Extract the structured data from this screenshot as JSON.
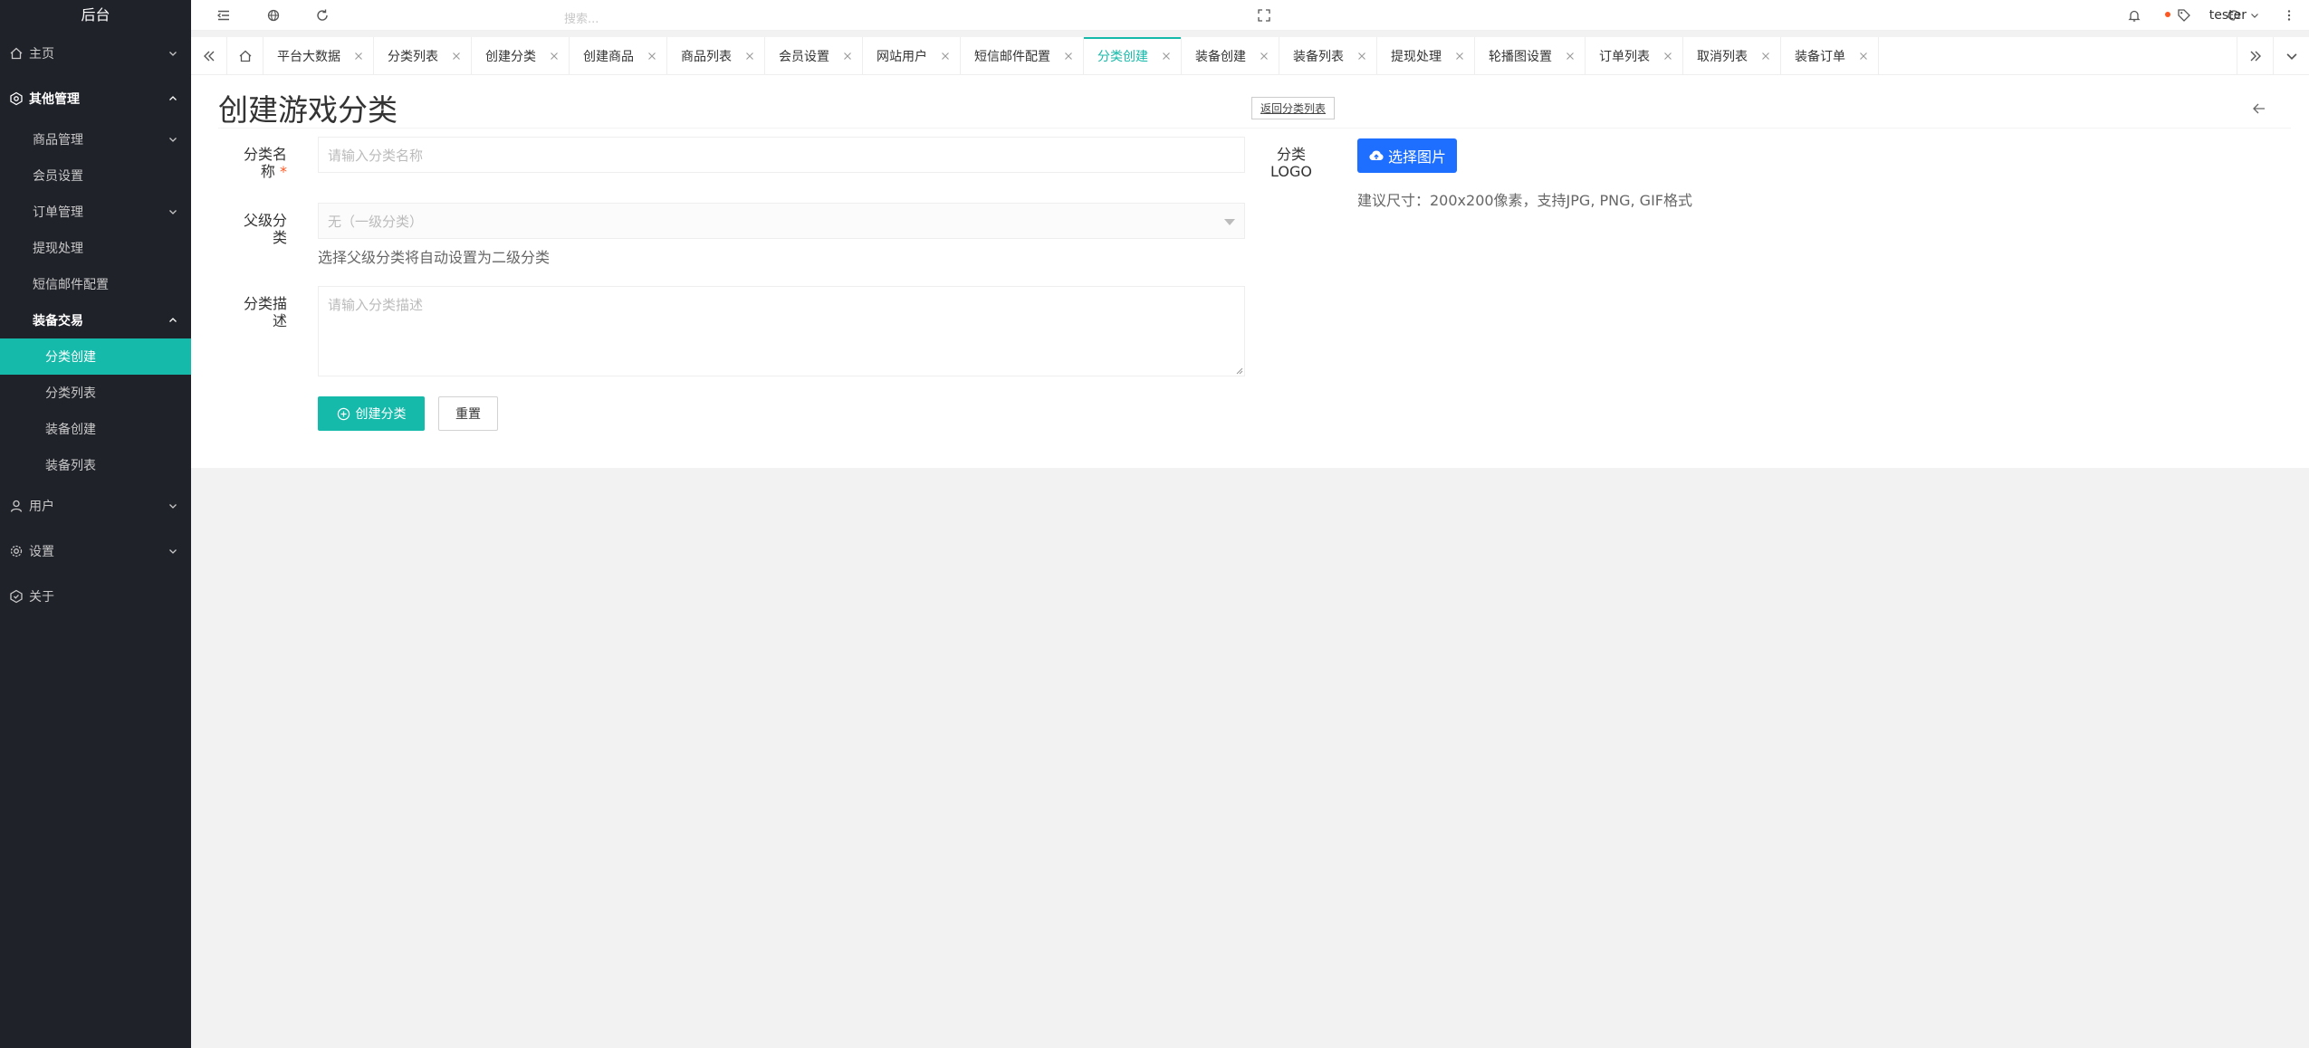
{
  "app": {
    "title": "后台"
  },
  "colors": {
    "accent": "#16baaa",
    "sidebar_bg": "#20222a",
    "upload_blue": "#1e6fff",
    "required": "#ff5722"
  },
  "sidebar": {
    "home": "主页",
    "other_mgmt": "其他管理",
    "product_mgmt": "商品管理",
    "member_settings": "会员设置",
    "order_mgmt": "订单管理",
    "withdraw": "提现处理",
    "sms_mail": "短信邮件配置",
    "equip_trade": "装备交易",
    "cat_create": "分类创建",
    "cat_list": "分类列表",
    "equip_create": "装备创建",
    "equip_list": "装备列表",
    "users": "用户",
    "settings": "设置",
    "about": "关于"
  },
  "header": {
    "search_placeholder": "搜索...",
    "user": "tester"
  },
  "tabs": [
    "平台大数据",
    "分类列表",
    "创建分类",
    "创建商品",
    "商品列表",
    "会员设置",
    "网站用户",
    "短信邮件配置",
    "分类创建",
    "装备创建",
    "装备列表",
    "提现处理",
    "轮播图设置",
    "订单列表",
    "取消列表",
    "装备订单"
  ],
  "active_tab": "分类创建",
  "page": {
    "title": "创建游戏分类",
    "back_link": "返回分类列表",
    "name_label_1": "分类名",
    "name_label_2": "称",
    "required_mark": "*",
    "name_placeholder": "请输入分类名称",
    "parent_label_1": "父级分",
    "parent_label_2": "类",
    "parent_value": "无（一级分类）",
    "parent_tip": "选择父级分类将自动设置为二级分类",
    "desc_label_1": "分类描",
    "desc_label_2": "述",
    "desc_placeholder": "请输入分类描述",
    "logo_label_1": "分类",
    "logo_label_2": "LOGO",
    "upload_button": "选择图片",
    "logo_tip": "建议尺寸：200x200像素，支持JPG, PNG, GIF格式",
    "submit_button": "创建分类",
    "reset_button": "重置"
  }
}
